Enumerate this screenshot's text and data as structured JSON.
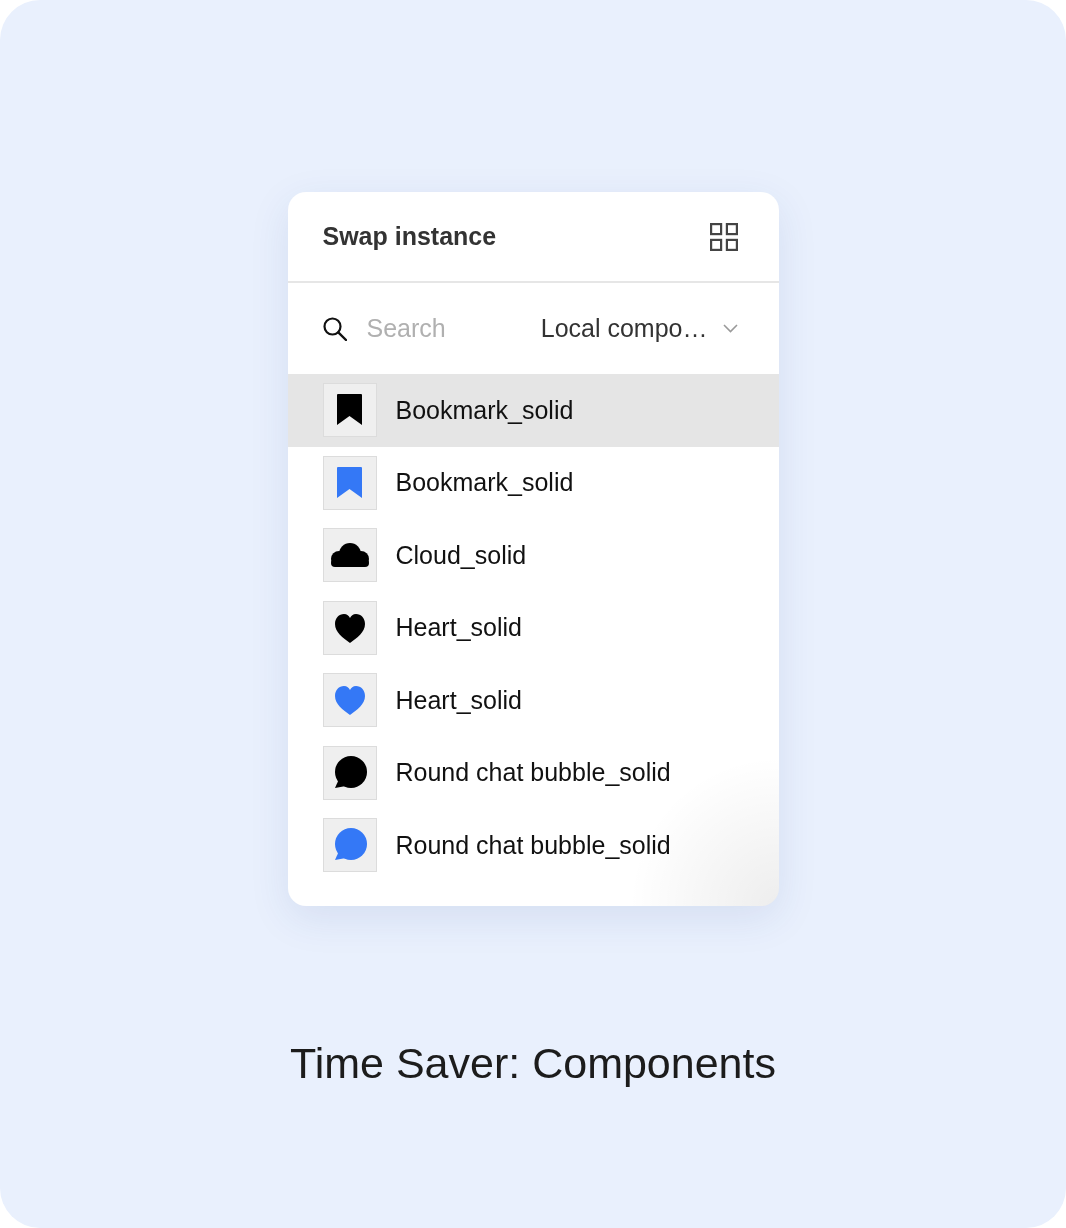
{
  "panel": {
    "title": "Swap instance",
    "search": {
      "placeholder": "Search"
    },
    "library_dropdown": {
      "value": "Local compo…"
    },
    "items": [
      {
        "label": "Bookmark_solid",
        "kind": "bookmark",
        "color": "#000000",
        "selected": true
      },
      {
        "label": "Bookmark_solid",
        "kind": "bookmark",
        "color": "#3478f6",
        "selected": false
      },
      {
        "label": "Cloud_solid",
        "kind": "cloud",
        "color": "#000000",
        "selected": false
      },
      {
        "label": "Heart_solid",
        "kind": "heart",
        "color": "#000000",
        "selected": false
      },
      {
        "label": "Heart_solid",
        "kind": "heart",
        "color": "#3478f6",
        "selected": false
      },
      {
        "label": "Round chat bubble_solid",
        "kind": "chat",
        "color": "#000000",
        "selected": false
      },
      {
        "label": "Round chat bubble_solid",
        "kind": "chat",
        "color": "#3478f6",
        "selected": false
      }
    ]
  },
  "caption": "Time Saver: Components"
}
